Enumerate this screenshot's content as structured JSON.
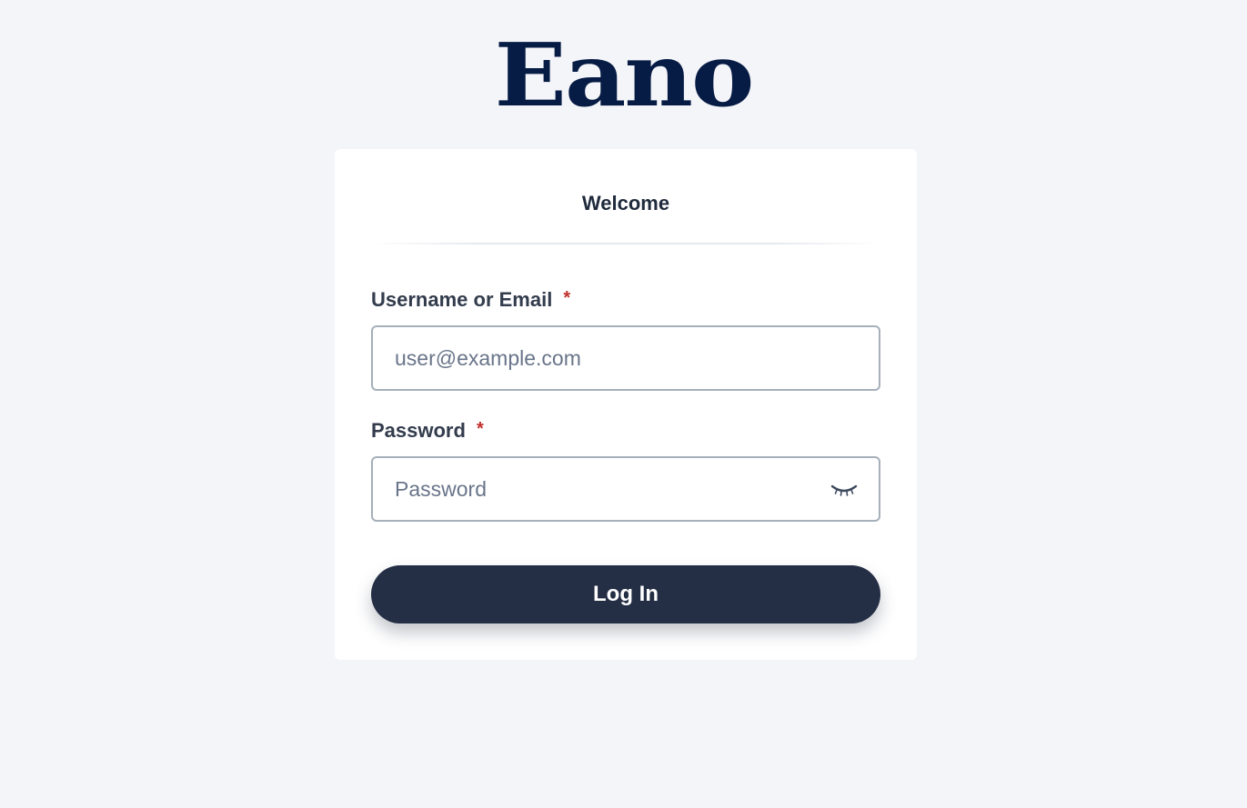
{
  "brand": {
    "logo_text": "Eano",
    "logo_color": "#071c45"
  },
  "card": {
    "title": "Welcome"
  },
  "form": {
    "username": {
      "label": "Username or Email",
      "required_mark": "*",
      "placeholder": "user@example.com",
      "value": ""
    },
    "password": {
      "label": "Password",
      "required_mark": "*",
      "placeholder": "Password",
      "value": "",
      "toggle_icon": "eye-closed-icon"
    },
    "submit_label": "Log In"
  },
  "colors": {
    "background": "#f4f5f9",
    "button": "#242e44",
    "required": "#c0302b"
  }
}
